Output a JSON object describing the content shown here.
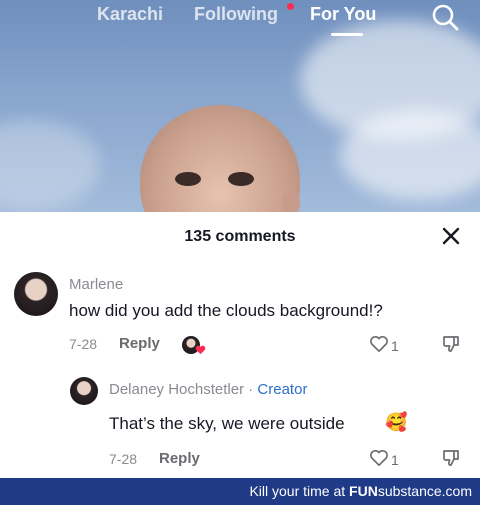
{
  "nav": {
    "tabs": [
      {
        "label": "Karachi"
      },
      {
        "label": "Following"
      },
      {
        "label": "For You"
      }
    ],
    "active_tab": "For You",
    "search_icon": "search-icon"
  },
  "comments_sheet": {
    "title": "135 comments",
    "close_icon": "close-icon",
    "comments": [
      {
        "username": "Marlene",
        "text": "how did you add the clouds background!?",
        "date": "7-28",
        "reply_label": "Reply",
        "likes": "1"
      },
      {
        "username": "Delaney Hochstetler",
        "separator": "·",
        "badge": "Creator",
        "text": "That’s the sky, we were outside",
        "emoji": "🥰",
        "date": "7-28",
        "reply_label": "Reply",
        "likes": "1"
      }
    ]
  },
  "footer": {
    "prefix": "Kill your time at ",
    "brand_fun": "FUN",
    "brand_rest": "substance",
    "suffix": ".com"
  },
  "colors": {
    "accent_red": "#fe2c55",
    "creator_blue": "#2b6fc9",
    "footer_bg": "#1f3a86"
  }
}
